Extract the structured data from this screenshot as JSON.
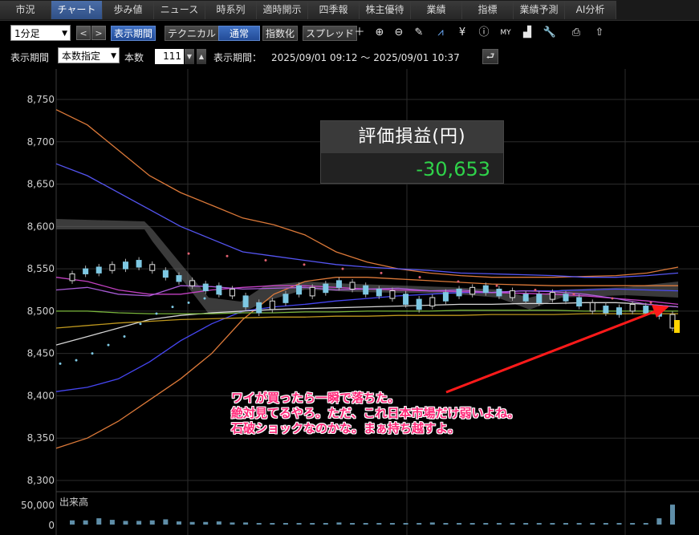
{
  "tabs": [
    "市況",
    "チャート",
    "歩み値",
    "ニュース",
    "時系列",
    "適時開示",
    "四季報",
    "株主優待",
    "業績",
    "指標",
    "業績予測",
    "AI分析"
  ],
  "active_tab": "チャート",
  "toolbar": {
    "interval": "1分足",
    "prev": "<",
    "next": ">",
    "display_period": "表示期間",
    "technical": "テクニカル",
    "normal": "通常",
    "index": "指数化",
    "spread": "スプレッド",
    "icons": [
      "plus-icon",
      "zoom-in-icon",
      "zoom-out-icon",
      "pencil-icon",
      "trend-line-icon",
      "yen-icon",
      "info-icon",
      "my-indicator-icon",
      "area-chart-icon",
      "wrench-icon",
      "print-icon",
      "export-icon"
    ]
  },
  "period_bar": {
    "label": "表示期間",
    "mode": "本数指定",
    "count_label": "本数",
    "count": "111",
    "range_label": "表示期間：",
    "range": "2025/09/01 09:12 ～ 2025/09/01 10:37"
  },
  "pnl": {
    "title": "評価損益(円)",
    "value": "-30,653"
  },
  "annotation": [
    "ワイが買ったら一瞬で落ちた。",
    "絶対見てるやろ。ただ、これ日本市場だけ弱いよね。",
    "石破ショックなのかな。まぁ持ち越すよ。"
  ],
  "volume_label": "出来高",
  "colors": {
    "up_candle": "#ffffff",
    "down_candle": "#7ec8e3",
    "arrow": "#ff1a1a",
    "pnl_value": "#2fd34a",
    "annotation": "#ff2a7a"
  },
  "chart_data": {
    "type": "line",
    "title": "",
    "y_axis_ticks": [
      "8,750",
      "8,700",
      "8,650",
      "8,600",
      "8,550",
      "8,500",
      "8,450",
      "8,400",
      "8,350",
      "8,300"
    ],
    "ylim": [
      8300,
      8760
    ],
    "volume_ticks": [
      "50,000",
      "0"
    ],
    "x_gridline_count": 3,
    "grid": true,
    "series": [
      {
        "values": [
          8738,
          8720,
          8690,
          8660,
          8640,
          8625,
          8610,
          8602,
          8590,
          8570,
          8558,
          8550,
          8545,
          8542,
          8540,
          8540,
          8540,
          8541,
          8542,
          8545,
          8552
        ]
      },
      {
        "values": [
          8338,
          8350,
          8370,
          8395,
          8420,
          8450,
          8490,
          8520,
          8535,
          8540,
          8540,
          8538,
          8536,
          8534,
          8532,
          8531,
          8530,
          8530,
          8530,
          8530,
          8530
        ]
      },
      {
        "values": [
          8674,
          8660,
          8640,
          8620,
          8600,
          8585,
          8570,
          8565,
          8560,
          8555,
          8552,
          8550,
          8548,
          8545,
          8544,
          8543,
          8542,
          8540,
          8540,
          8542,
          8545
        ]
      },
      {
        "values": [
          8405,
          8410,
          8420,
          8440,
          8465,
          8485,
          8500,
          8505,
          8508,
          8512,
          8515,
          8518,
          8520,
          8522,
          8522,
          8524,
          8524,
          8525,
          8526,
          8525,
          8524
        ]
      },
      {
        "values": [
          8460,
          8470,
          8480,
          8490,
          8495,
          8498,
          8500,
          8502,
          8503,
          8504,
          8505,
          8506,
          8507,
          8508,
          8508,
          8509,
          8509,
          8510,
          8510,
          8508,
          8505
        ]
      },
      {
        "values": [
          8540,
          8535,
          8525,
          8520,
          8520,
          8525,
          8528,
          8530,
          8530,
          8528,
          8526,
          8525,
          8524,
          8523,
          8522,
          8521,
          8520,
          8518,
          8515,
          8512,
          8508
        ]
      },
      {
        "values": [
          8480,
          8483,
          8486,
          8488,
          8490,
          8491,
          8492,
          8493,
          8493,
          8494,
          8494,
          8495,
          8495,
          8495,
          8496,
          8496,
          8496,
          8497,
          8497,
          8497,
          8497
        ]
      },
      {
        "values": [
          8500,
          8500,
          8498,
          8497,
          8497,
          8497,
          8498,
          8498,
          8499,
          8499,
          8500,
          8500,
          8500,
          8501,
          8501,
          8501,
          8501,
          8500,
          8500,
          8500,
          8500
        ]
      },
      {
        "values": [
          8525,
          8528,
          8520,
          8518,
          8530,
          8529,
          8526,
          8527,
          8528,
          8525,
          8526,
          8527,
          8524,
          8525,
          8522,
          8524,
          8523,
          8520,
          8515,
          8508,
          8505
        ]
      }
    ],
    "candles": [
      [
        8536,
        8544
      ],
      [
        8544,
        8550
      ],
      [
        8545,
        8552
      ],
      [
        8548,
        8555
      ],
      [
        8550,
        8558
      ],
      [
        8552,
        8560
      ],
      [
        8548,
        8555
      ],
      [
        8540,
        8548
      ],
      [
        8535,
        8542
      ],
      [
        8530,
        8536
      ],
      [
        8524,
        8532
      ],
      [
        8520,
        8530
      ],
      [
        8518,
        8526
      ],
      [
        8505,
        8518
      ],
      [
        8498,
        8510
      ],
      [
        8502,
        8512
      ],
      [
        8510,
        8520
      ],
      [
        8520,
        8530
      ],
      [
        8518,
        8528
      ],
      [
        8522,
        8532
      ],
      [
        8528,
        8536
      ],
      [
        8526,
        8534
      ],
      [
        8520,
        8530
      ],
      [
        8518,
        8526
      ],
      [
        8515,
        8524
      ],
      [
        8508,
        8520
      ],
      [
        8502,
        8514
      ],
      [
        8506,
        8516
      ],
      [
        8512,
        8522
      ],
      [
        8518,
        8526
      ],
      [
        8520,
        8528
      ],
      [
        8522,
        8530
      ],
      [
        8518,
        8526
      ],
      [
        8516,
        8524
      ],
      [
        8512,
        8520
      ],
      [
        8510,
        8520
      ],
      [
        8514,
        8522
      ],
      [
        8512,
        8520
      ],
      [
        8506,
        8516
      ],
      [
        8500,
        8510
      ],
      [
        8498,
        8506
      ],
      [
        8496,
        8504
      ],
      [
        8500,
        8508
      ],
      [
        8498,
        8506
      ],
      [
        8494,
        8502
      ],
      [
        8480,
        8496
      ]
    ],
    "psar": [
      [
        0,
        8438
      ],
      [
        2,
        8442
      ],
      [
        4,
        8450
      ],
      [
        6,
        8460
      ],
      [
        8,
        8470
      ],
      [
        10,
        8485
      ],
      [
        12,
        8497
      ],
      [
        14,
        8505
      ],
      [
        16,
        8510
      ],
      [
        18,
        8515
      ],
      [
        20,
        8520
      ],
      [
        6,
        8568
      ],
      [
        8,
        8565
      ],
      [
        10,
        8560
      ],
      [
        12,
        8555
      ],
      [
        14,
        8550
      ],
      [
        16,
        8545
      ],
      [
        18,
        8540
      ],
      [
        20,
        8535
      ],
      [
        22,
        8530
      ],
      [
        24,
        8525
      ],
      [
        26,
        8520
      ],
      [
        28,
        8515
      ],
      [
        30,
        8510
      ]
    ],
    "volume": [
      8000,
      8000,
      12000,
      9000,
      7000,
      7000,
      8000,
      10000,
      6000,
      5000,
      5000,
      6000,
      4000,
      4000,
      3000,
      3000,
      3000,
      3000,
      3000,
      3000,
      4000,
      3000,
      3000,
      3000,
      3000,
      3000,
      3000,
      4000,
      3000,
      3000,
      3000,
      3000,
      3000,
      3000,
      3000,
      3000,
      3000,
      3000,
      3000,
      3000,
      3000,
      3000,
      3000,
      3000,
      12000,
      38000
    ]
  }
}
